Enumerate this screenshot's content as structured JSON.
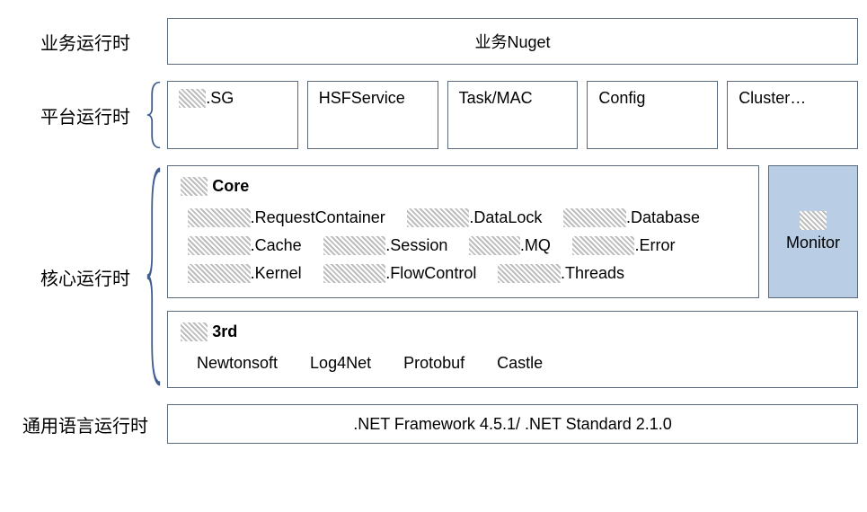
{
  "rows": {
    "business": {
      "label": "业务运行时",
      "box": "业务Nuget"
    },
    "platform": {
      "label": "平台运行时",
      "boxes": [
        {
          "prefix": "▓▓",
          "suffix": ".SG"
        },
        {
          "text": "HSFService"
        },
        {
          "text": "Task/MAC"
        },
        {
          "text": "Config"
        },
        {
          "text": "Cluster…"
        }
      ]
    },
    "core": {
      "label": "核心运行时",
      "core_title_prefix": "▓▓",
      "core_title": " Core",
      "core_items": [
        {
          "prefix": "▓▓▓▓▓",
          "suffix": ".RequestContainer"
        },
        {
          "prefix": "▓▓▓▓▓",
          "suffix": ".DataLock"
        },
        {
          "prefix": "▓▓▓▓▓",
          "suffix": ".Database"
        },
        {
          "prefix": "▓▓▓▓▓",
          "suffix": ".Cache"
        },
        {
          "prefix": "▓▓▓▓▓",
          "suffix": ".Session"
        },
        {
          "prefix": "▓▓▓▓",
          "suffix": ".MQ"
        },
        {
          "prefix": "▓▓▓▓▓",
          "suffix": ".Error"
        },
        {
          "prefix": "▓▓▓▓▓",
          "suffix": ".Kernel"
        },
        {
          "prefix": "▓▓▓▓▓",
          "suffix": ".FlowControl"
        },
        {
          "prefix": "▓▓▓▓▓",
          "suffix": ".Threads"
        }
      ],
      "monitor_prefix": "▓▓",
      "monitor_label": "Monitor",
      "brd_title_prefix": "▓▓",
      "brd_title": " 3rd",
      "brd_items": [
        "Newtonsoft",
        "Log4Net",
        "Protobuf",
        "Castle"
      ]
    },
    "clr": {
      "label": "通用语言运行时",
      "box": ".NET Framework 4.5.1/ .NET Standard 2.1.0"
    }
  }
}
